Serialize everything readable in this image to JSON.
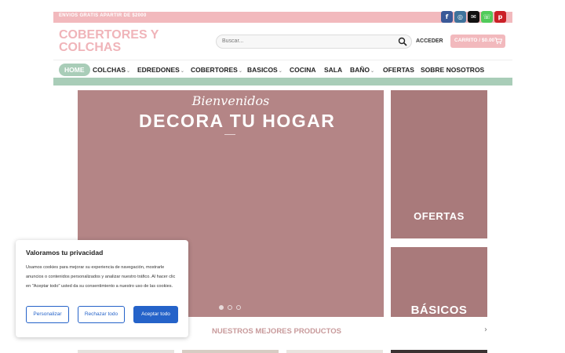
{
  "topbar": {
    "promo": "ENVIOS GRATIS APARTIR DE $2000",
    "social": [
      {
        "icon": "facebook-icon",
        "glyph": "f",
        "color": "#3b5998"
      },
      {
        "icon": "instagram-icon",
        "glyph": "◎",
        "color": "#3f729b"
      },
      {
        "icon": "mail-icon",
        "glyph": "✉",
        "color": "#111111"
      },
      {
        "icon": "phone-icon",
        "glyph": "☏",
        "color": "#51cb5a"
      },
      {
        "icon": "pinterest-icon",
        "glyph": "p",
        "color": "#cb2027"
      }
    ]
  },
  "header": {
    "logo": "COBERTORES Y COLCHAS",
    "search_placeholder": "Buscar...",
    "login": "ACCEDER",
    "cart": "CARRITO / $0.00"
  },
  "nav": {
    "items": [
      {
        "label": "HOME",
        "dropdown": false
      },
      {
        "label": "COLCHAS",
        "dropdown": true
      },
      {
        "label": "EDREDONES",
        "dropdown": true
      },
      {
        "label": "COBERTORES",
        "dropdown": true
      },
      {
        "label": "BASICOS",
        "dropdown": true
      },
      {
        "label": "COCINA",
        "dropdown": false
      },
      {
        "label": "SALA",
        "dropdown": false
      },
      {
        "label": "BAÑO",
        "dropdown": true
      },
      {
        "label": "OFERTAS",
        "dropdown": false
      },
      {
        "label": "SOBRE NOSOTROS",
        "dropdown": false
      }
    ]
  },
  "hero": {
    "script": "Bienvenidos",
    "title": "DECORA TU HOGAR",
    "slides": 3,
    "active_slide": 1
  },
  "cards": {
    "offers": "OFERTAS",
    "basics": "BÁSICOS"
  },
  "products": {
    "title": "NUESTROS MEJORES PRODUCTOS"
  },
  "cookie": {
    "title": "Valoramos tu privacidad",
    "body": "Usamos cookies para mejorar su experiencia de navegación, mostrarle anuncios o contenidos personalizados y analizar nuestro tráfico. Al hacer clic en \"Aceptar todo\" usted da su consentimiento a nuestro uso de las cookies.",
    "customize": "Personalizar",
    "reject": "Rechazar todo",
    "accept": "Aceptar todo"
  },
  "colors": {
    "pink": "#f2b9bd",
    "mint": "#a9cdb8",
    "hero": "#b48586",
    "card": "#a97a7b",
    "cookie_button": "#2563c9"
  }
}
